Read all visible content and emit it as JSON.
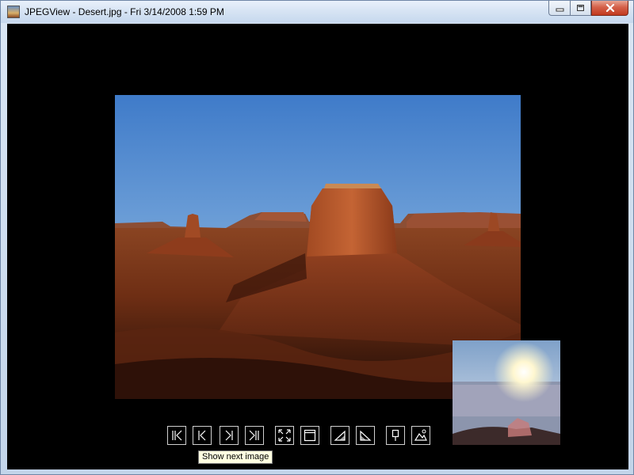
{
  "window": {
    "title": "JPEGView - Desert.jpg - Fri 3/14/2008 1:59 PM",
    "app_icon": "image-icon"
  },
  "caption": {
    "minimize_icon": "minimize-icon",
    "maximize_icon": "maximize-icon",
    "close_icon": "close-icon"
  },
  "viewer": {
    "image_subject": "desert buttes at sunset",
    "navigator_subject": "sun over horizon"
  },
  "toolbar": {
    "buttons": [
      {
        "name": "first-image-button",
        "icon": "skip-first-icon"
      },
      {
        "name": "previous-image-button",
        "icon": "previous-icon"
      },
      {
        "name": "next-image-button",
        "icon": "next-icon"
      },
      {
        "name": "last-image-button",
        "icon": "skip-last-icon"
      },
      {
        "name": "fit-to-screen-button",
        "icon": "fit-screen-icon"
      },
      {
        "name": "window-mode-button",
        "icon": "window-icon"
      },
      {
        "name": "rotate-left-button",
        "icon": "rotate-left-icon"
      },
      {
        "name": "rotate-right-button",
        "icon": "rotate-right-icon"
      },
      {
        "name": "keep-params-button",
        "icon": "pin-icon"
      },
      {
        "name": "landscape-mode-button",
        "icon": "landscape-icon"
      }
    ]
  },
  "tooltip": {
    "text": "Show next image"
  },
  "colors": {
    "background": "#000000",
    "toolbar_outline": "#cfcfcf",
    "tooltip_bg": "#ffffe1"
  }
}
